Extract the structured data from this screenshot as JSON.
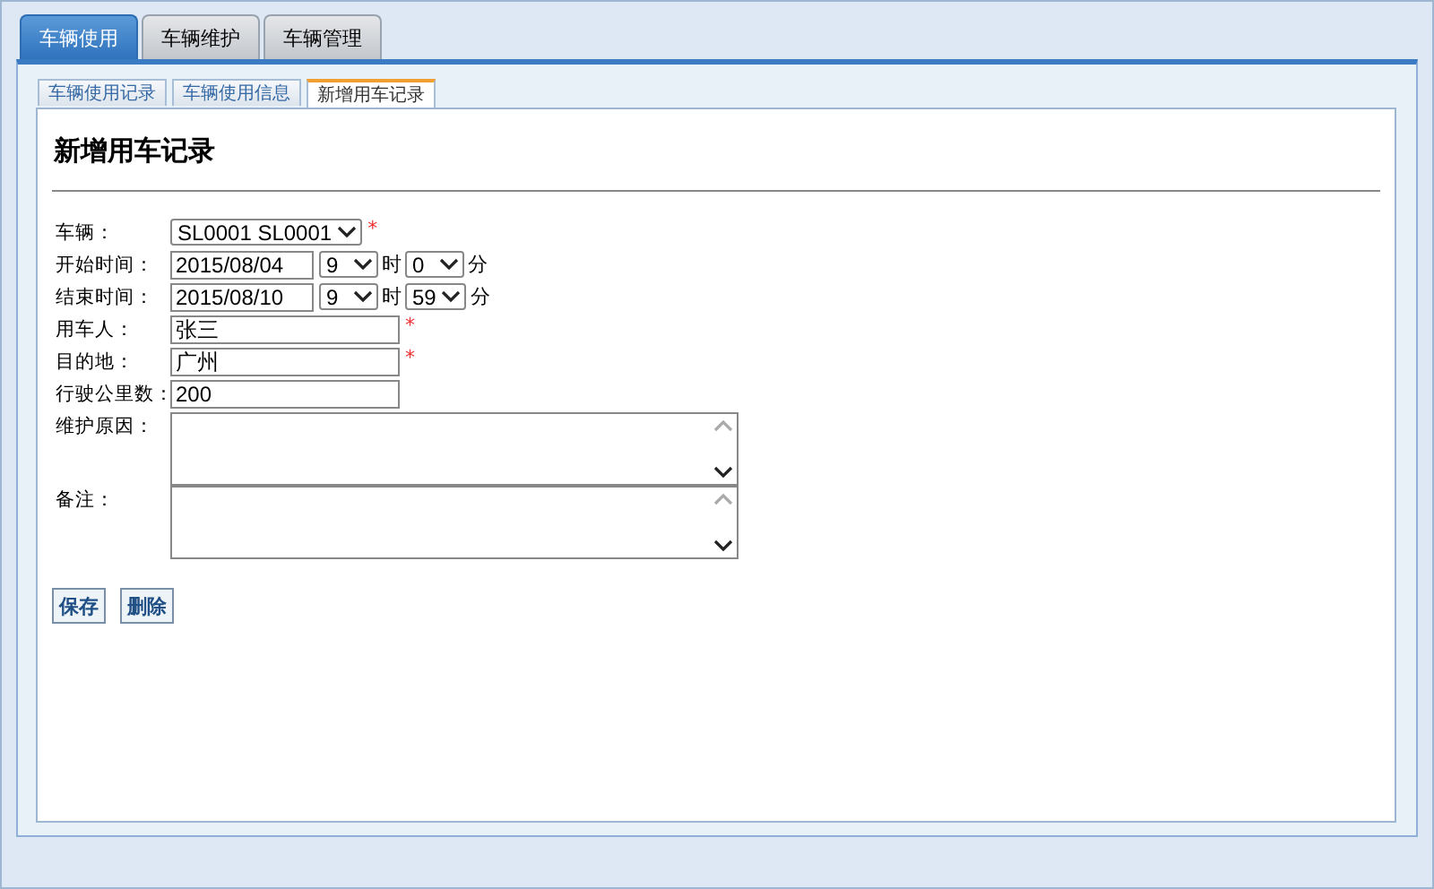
{
  "main_tabs": [
    {
      "label": "车辆使用",
      "selected": true
    },
    {
      "label": "车辆维护",
      "selected": false
    },
    {
      "label": "车辆管理",
      "selected": false
    }
  ],
  "sub_tabs": [
    {
      "label": "车辆使用记录",
      "selected": false
    },
    {
      "label": "车辆使用信息",
      "selected": false
    },
    {
      "label": "新增用车记录",
      "selected": true
    }
  ],
  "form": {
    "title": "新增用车记录",
    "fields": [
      {
        "kind": "select",
        "label": "车辆：",
        "value": "SL0001 SL0001",
        "required_mark": "*"
      },
      {
        "kind": "datetime",
        "label": "开始时间：",
        "date": "2015/08/04",
        "hour": "9",
        "hour_unit": "时",
        "minute": "0",
        "minute_unit": "分"
      },
      {
        "kind": "datetime",
        "label": "结束时间：",
        "date": "2015/08/10",
        "hour": "9",
        "hour_unit": "时",
        "minute": "59",
        "minute_unit": "分"
      },
      {
        "kind": "text",
        "label": "用车人：",
        "value": "张三",
        "required_mark": "*"
      },
      {
        "kind": "text",
        "label": "目的地：",
        "value": "广州",
        "required_mark": "*"
      },
      {
        "kind": "text",
        "label": "行驶公里数：",
        "value": "200"
      },
      {
        "kind": "textarea",
        "label": "维护原因："
      },
      {
        "kind": "textarea",
        "label": "备注："
      }
    ]
  },
  "buttons": [
    "保存",
    "删除"
  ]
}
